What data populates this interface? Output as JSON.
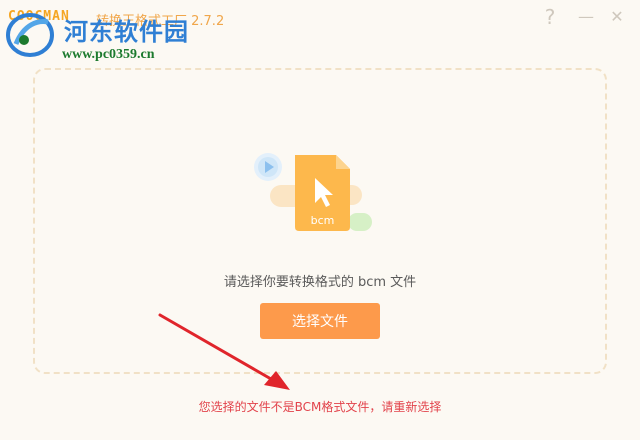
{
  "window": {
    "brand": "COOCMAN",
    "title": "转换王格式工厂 2.7.2",
    "help_glyph": "?",
    "minimize_glyph": "—",
    "close_glyph": "✕"
  },
  "watermark": {
    "site_name": "河东软件园",
    "url": "www.pc0359.cn"
  },
  "dropzone": {
    "file_badge": "bcm",
    "prompt": "请选择你要转换格式的 bcm 文件",
    "select_button": "选择文件"
  },
  "error_message": "您选择的文件不是BCM格式文件，请重新选择",
  "colors": {
    "accent": "#fd9a4b",
    "file_icon": "#fdb84c",
    "error": "#e2434b",
    "background": "#fcf9f3"
  }
}
